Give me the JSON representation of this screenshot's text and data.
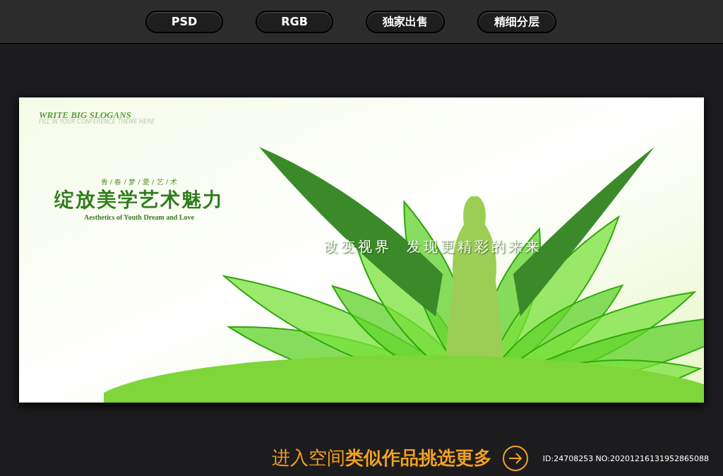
{
  "format_tags": [
    "PSD",
    "RGB",
    "独家出售",
    "精细分层"
  ],
  "poster": {
    "header_title": "WRITE BIG SLOGANS",
    "header_subtitle": "FILL IN YOUR CONFERENCE THEME HERE",
    "small_title": "青 / 春 / 梦 / 爱 / 艺 / 术",
    "main_title": "绽放美学艺术魅力",
    "english_subtitle": "Aesthetics of Youth Dream and Love",
    "slogan": "改变视界  发现更精彩的来来"
  },
  "footer": {
    "link": "进入空间**类似作品挑选更多**",
    "id_text": "ID:24708253 NO:20201216131952865088"
  }
}
